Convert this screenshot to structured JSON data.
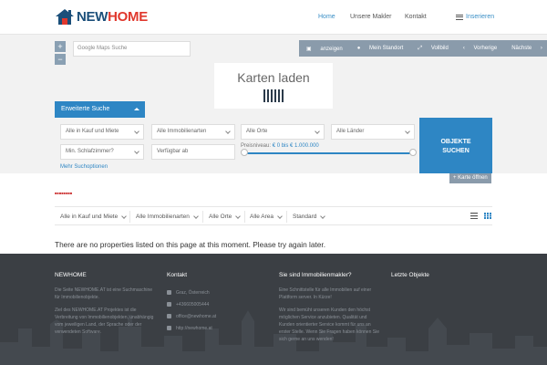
{
  "header": {
    "logo_part1": "NEW",
    "logo_part2": "HOME",
    "nav": [
      "Home",
      "Unsere Makler",
      "Kontakt"
    ],
    "inserieren": "Inserieren"
  },
  "map": {
    "zoom_in": "+",
    "zoom_out": "−",
    "search_placeholder": "Google Maps Suche",
    "toolbar": [
      "anzeigen",
      "Mein Standort",
      "Vollbild",
      "Vorherige",
      "Nächste"
    ],
    "loading_text": "Karten laden",
    "karte_offnen": "Karte öffnen"
  },
  "search": {
    "advanced_label": "Erweiterte Suche",
    "selects": [
      "Alle in Kauf und Miete",
      "Alle Immobilienarten",
      "Alle Orte",
      "Alle Länder"
    ],
    "bedrooms_placeholder": "Min. Schlafzimmer?",
    "available_placeholder": "Verfügbar ab",
    "price_prefix": "Preisniveau:",
    "price_range": "€ 0 bis € 1.000.000",
    "price_min_fraction": 0,
    "price_max_fraction": 1,
    "submit_label_line1": "OBJEKTE",
    "submit_label_line2": "SUCHEN",
    "more_options": "Mehr Suchoptionen"
  },
  "listing": {
    "filters": [
      "Alle in Kauf und Miete",
      "Alle Immobilienarten",
      "Alle Orte",
      "Alle Area",
      "Standard"
    ],
    "empty_message": "There are no properties listed on this page at this moment. Please try again later."
  },
  "footer": {
    "col1": {
      "title": "NEWHOME",
      "text1": "Die Seite NEWHOME.AT ist eine Suchmaschine für Immobilienobjekte.",
      "text2": "Ziel des NEWHOME.AT Projektes ist die Verbreitung von Immobilienobjekten, unabhängig vom jeweiligen Land, der Sprache oder der verwendeten Software."
    },
    "col2": {
      "title": "Kontakt",
      "items": [
        "Graz, Österreich",
        "+436605005444",
        "office@newhome.at",
        "http://newhome.at"
      ]
    },
    "col3": {
      "title": "Sie sind Immobilienmakler?",
      "text1": "Eine Schnittstelle für alle Immobilien auf einer Plattform server. In Kürze!",
      "text2": "Wir sind bemüht unseren Kunden den höchst möglichen Service anzubieten. Qualität und Kunden orientierter Service kommt für uns an erster Stelle. Wenn Sie Fragen haben können Sie sich gerne an uns wenden!"
    },
    "col4": {
      "title": "Letzte Objekte"
    }
  },
  "colors": {
    "accent": "#2e86c4",
    "toolbar": "#8a9bab",
    "footer_bg": "#3b3f44",
    "logo_dark": "#1b4f7a",
    "logo_red": "#e0382d"
  }
}
